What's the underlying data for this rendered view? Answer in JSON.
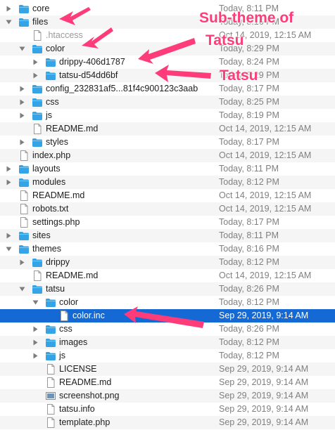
{
  "colors": {
    "folder_blue": "#35a4e7",
    "selection": "#1469d4",
    "annotation": "#ff3c7a",
    "date_text": "#808080"
  },
  "rows": [
    {
      "name": "core",
      "date": "Today, 8:11 PM",
      "type": "folder",
      "depth": 0,
      "disclosure": "closed"
    },
    {
      "name": "files",
      "date": "Today, 8:16 PM",
      "type": "folder",
      "depth": 0,
      "disclosure": "open"
    },
    {
      "name": ".htaccess",
      "date": "Oct 14, 2019, 12:15 AM",
      "type": "file",
      "depth": 1,
      "disclosure": "none",
      "dim": true
    },
    {
      "name": "color",
      "date": "Today, 8:29 PM",
      "type": "folder",
      "depth": 1,
      "disclosure": "open"
    },
    {
      "name": "drippy-406d1787",
      "date": "Today, 8:24 PM",
      "type": "folder",
      "depth": 2,
      "disclosure": "closed"
    },
    {
      "name": "tatsu-d54dd6bf",
      "date": "Today, 8:29 PM",
      "type": "folder",
      "depth": 2,
      "disclosure": "closed"
    },
    {
      "name": "config_232831af5...81f4c900123c3aab",
      "date": "Today, 8:17 PM",
      "type": "folder",
      "depth": 1,
      "disclosure": "closed"
    },
    {
      "name": "css",
      "date": "Today, 8:25 PM",
      "type": "folder",
      "depth": 1,
      "disclosure": "closed"
    },
    {
      "name": "js",
      "date": "Today, 8:19 PM",
      "type": "folder",
      "depth": 1,
      "disclosure": "closed"
    },
    {
      "name": "README.md",
      "date": "Oct 14, 2019, 12:15 AM",
      "type": "file",
      "depth": 1,
      "disclosure": "none"
    },
    {
      "name": "styles",
      "date": "Today, 8:17 PM",
      "type": "folder",
      "depth": 1,
      "disclosure": "closed"
    },
    {
      "name": "index.php",
      "date": "Oct 14, 2019, 12:15 AM",
      "type": "file",
      "depth": 0,
      "disclosure": "none"
    },
    {
      "name": "layouts",
      "date": "Today, 8:11 PM",
      "type": "folder",
      "depth": 0,
      "disclosure": "closed"
    },
    {
      "name": "modules",
      "date": "Today, 8:12 PM",
      "type": "folder",
      "depth": 0,
      "disclosure": "closed"
    },
    {
      "name": "README.md",
      "date": "Oct 14, 2019, 12:15 AM",
      "type": "file",
      "depth": 0,
      "disclosure": "none"
    },
    {
      "name": "robots.txt",
      "date": "Oct 14, 2019, 12:15 AM",
      "type": "file",
      "depth": 0,
      "disclosure": "none"
    },
    {
      "name": "settings.php",
      "date": "Today, 8:17 PM",
      "type": "file",
      "depth": 0,
      "disclosure": "none"
    },
    {
      "name": "sites",
      "date": "Today, 8:11 PM",
      "type": "folder",
      "depth": 0,
      "disclosure": "closed"
    },
    {
      "name": "themes",
      "date": "Today, 8:16 PM",
      "type": "folder",
      "depth": 0,
      "disclosure": "open"
    },
    {
      "name": "drippy",
      "date": "Today, 8:12 PM",
      "type": "folder",
      "depth": 1,
      "disclosure": "closed"
    },
    {
      "name": "README.md",
      "date": "Oct 14, 2019, 12:15 AM",
      "type": "file",
      "depth": 1,
      "disclosure": "none"
    },
    {
      "name": "tatsu",
      "date": "Today, 8:26 PM",
      "type": "folder",
      "depth": 1,
      "disclosure": "open"
    },
    {
      "name": "color",
      "date": "Today, 8:12 PM",
      "type": "folder",
      "depth": 2,
      "disclosure": "open"
    },
    {
      "name": "color.inc",
      "date": "Sep 29, 2019, 9:14 AM",
      "type": "file",
      "depth": 3,
      "disclosure": "none",
      "selected": true
    },
    {
      "name": "css",
      "date": "Today, 8:26 PM",
      "type": "folder",
      "depth": 2,
      "disclosure": "closed"
    },
    {
      "name": "images",
      "date": "Today, 8:12 PM",
      "type": "folder",
      "depth": 2,
      "disclosure": "closed"
    },
    {
      "name": "js",
      "date": "Today, 8:12 PM",
      "type": "folder",
      "depth": 2,
      "disclosure": "closed"
    },
    {
      "name": "LICENSE",
      "date": "Sep 29, 2019, 9:14 AM",
      "type": "file",
      "depth": 2,
      "disclosure": "none"
    },
    {
      "name": "README.md",
      "date": "Sep 29, 2019, 9:14 AM",
      "type": "file",
      "depth": 2,
      "disclosure": "none"
    },
    {
      "name": "screenshot.png",
      "date": "Sep 29, 2019, 9:14 AM",
      "type": "image",
      "depth": 2,
      "disclosure": "none"
    },
    {
      "name": "tatsu.info",
      "date": "Sep 29, 2019, 9:14 AM",
      "type": "file",
      "depth": 2,
      "disclosure": "none"
    },
    {
      "name": "template.php",
      "date": "Sep 29, 2019, 9:14 AM",
      "type": "file",
      "depth": 2,
      "disclosure": "none"
    }
  ],
  "annotations": {
    "callout_line1": "Sub-theme of",
    "callout_line2": "Tatsu",
    "callout_tatsu": "Tatsu"
  }
}
